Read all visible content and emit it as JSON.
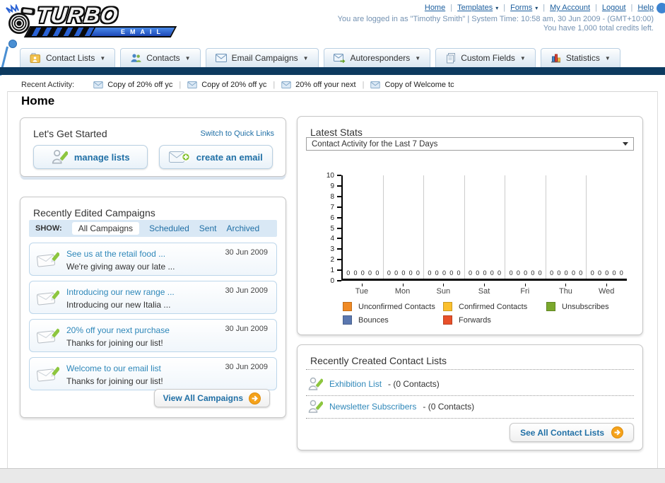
{
  "header": {
    "logo": {
      "turbo": "TURBO",
      "email": "EMAIL"
    },
    "nav_links": [
      {
        "label": "Home",
        "dropdown": false
      },
      {
        "label": "Templates",
        "dropdown": true
      },
      {
        "label": "Forms",
        "dropdown": true
      },
      {
        "label": "My Account",
        "dropdown": false
      },
      {
        "label": "Logout",
        "dropdown": false
      },
      {
        "label": "Help",
        "dropdown": false
      }
    ],
    "login_line1": "You are logged in as \"Timothy Smith\" | System Time: 10:58 am, 30 Jun 2009 - (GMT+10:00)",
    "login_line2": "You have 1,000 total credits left."
  },
  "tabs": [
    {
      "label": "Contact Lists",
      "icon": "address-book-icon"
    },
    {
      "label": "Contacts",
      "icon": "contacts-icon"
    },
    {
      "label": "Email Campaigns",
      "icon": "envelope-icon"
    },
    {
      "label": "Autoresponders",
      "icon": "envelope-arrow-icon"
    },
    {
      "label": "Custom Fields",
      "icon": "pages-icon"
    },
    {
      "label": "Statistics",
      "icon": "bar-chart-icon"
    }
  ],
  "recent_activity": {
    "label": "Recent Activity:",
    "items": [
      "Copy of 20% off yc",
      "Copy of 20% off yc",
      "20% off your next",
      "Copy of Welcome tc"
    ]
  },
  "page_title": "Home",
  "get_started": {
    "title": "Let's Get Started",
    "switch_link": "Switch to Quick Links",
    "buttons": [
      {
        "label": "manage lists"
      },
      {
        "label": "create an email"
      }
    ]
  },
  "campaigns": {
    "title": "Recently Edited Campaigns",
    "show_label": "SHOW:",
    "filters": [
      "All Campaigns",
      "Scheduled",
      "Sent",
      "Archived"
    ],
    "active_filter": "All Campaigns",
    "rows": [
      {
        "title": "See us at the retail food ...",
        "subtitle": "We're giving away our late ...",
        "date": "30 Jun 2009"
      },
      {
        "title": "Introducing our new range ...",
        "subtitle": "Introducing our new Italia ...",
        "date": "30 Jun 2009"
      },
      {
        "title": "20% off your next purchase",
        "subtitle": "Thanks for joining our list!",
        "date": "30 Jun 2009"
      },
      {
        "title": "Welcome to our email list",
        "subtitle": "Thanks for joining our list!",
        "date": "30 Jun 2009"
      }
    ],
    "view_all_label": "View All Campaigns"
  },
  "latest_stats": {
    "title": "Latest Stats",
    "dropdown_value": "Contact Activity for the Last 7 Days"
  },
  "chart_data": {
    "type": "bar",
    "categories": [
      "Tue",
      "Mon",
      "Sun",
      "Sat",
      "Fri",
      "Thu",
      "Wed"
    ],
    "series": [
      {
        "name": "Unconfirmed Contacts",
        "color": "#F08A24",
        "values": [
          0,
          0,
          0,
          0,
          0,
          0,
          0
        ]
      },
      {
        "name": "Confirmed Contacts",
        "color": "#FBC02D",
        "values": [
          0,
          0,
          0,
          0,
          0,
          0,
          0
        ]
      },
      {
        "name": "Unsubscribes",
        "color": "#7AA82C",
        "values": [
          0,
          0,
          0,
          0,
          0,
          0,
          0
        ]
      },
      {
        "name": "Bounces",
        "color": "#5B78B0",
        "values": [
          0,
          0,
          0,
          0,
          0,
          0,
          0
        ]
      },
      {
        "name": "Forwards",
        "color": "#E8502A",
        "values": [
          0,
          0,
          0,
          0,
          0,
          0,
          0
        ]
      }
    ],
    "title": "Contact Activity for the Last 7 Days",
    "xlabel": "",
    "ylabel": "",
    "ylim": [
      0,
      10
    ],
    "ytick_step": 1,
    "value_labels_shown": true,
    "grid": "vertical",
    "legend_position": "bottom"
  },
  "contact_lists": {
    "title": "Recently Created Contact Lists",
    "items": [
      {
        "name": "Exhibition List",
        "detail": "- (0 Contacts)"
      },
      {
        "name": "Newsletter Subscribers",
        "detail": "- (0 Contacts)"
      }
    ],
    "see_all_label": "See All Contact Lists"
  }
}
